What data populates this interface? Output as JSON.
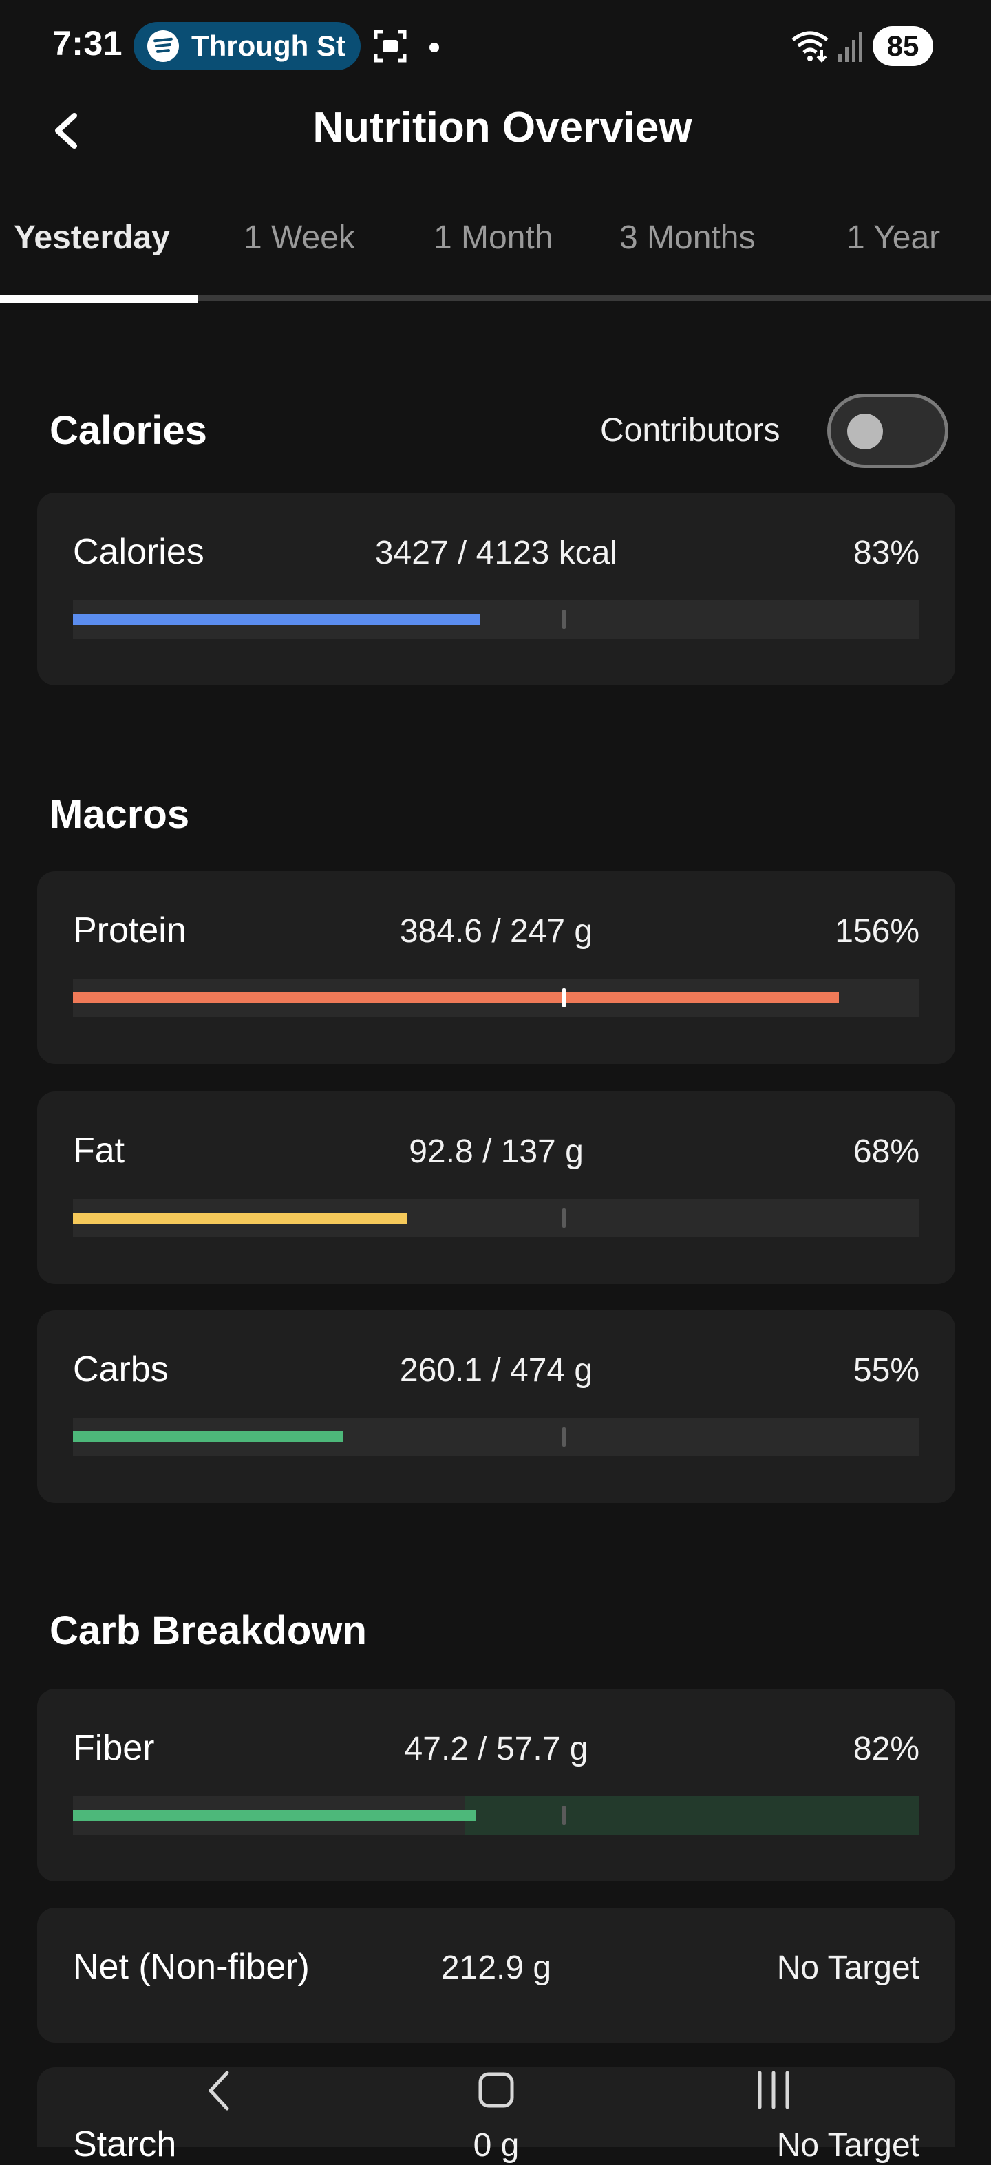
{
  "status_bar": {
    "time": "7:31",
    "media_text": "Through St",
    "battery": "85",
    "icons": [
      "spotify-icon",
      "screenshot-icon",
      "wifi-icon",
      "signal-icon"
    ]
  },
  "header": {
    "title": "Nutrition Overview",
    "back_icon": "chevron-left-icon"
  },
  "tabs": [
    {
      "label": "Yesterday",
      "active": true
    },
    {
      "label": "1 Week"
    },
    {
      "label": "1 Month"
    },
    {
      "label": "3 Months"
    },
    {
      "label": "1 Year"
    }
  ],
  "calories_section": {
    "title": "Calories",
    "contributors_label": "Contributors",
    "contributors_on": false,
    "card": {
      "name": "Calories",
      "amount": "3427 / 4123 kcal",
      "percent": "83%",
      "progress": 0.83,
      "color": "#5b8def"
    }
  },
  "macros_section": {
    "title": "Macros",
    "cards": [
      {
        "name": "Protein",
        "amount": "384.6 / 247 g",
        "percent": "156%",
        "progress": 1.56,
        "color": "#f07a58"
      },
      {
        "name": "Fat",
        "amount": "92.8 / 137 g",
        "percent": "68%",
        "progress": 0.68,
        "color": "#f5c95a"
      },
      {
        "name": "Carbs",
        "amount": "260.1 / 474 g",
        "percent": "55%",
        "progress": 0.55,
        "color": "#4db87a"
      }
    ]
  },
  "carb_breakdown_section": {
    "title": "Carb Breakdown",
    "cards": [
      {
        "name": "Fiber",
        "amount": "47.2 / 57.7 g",
        "percent": "82%",
        "progress": 0.82,
        "color": "#4db87a",
        "target_band_color": "#233a2c"
      },
      {
        "name": "Net (Non-fiber)",
        "amount": "212.9 g",
        "percent": "No Target"
      },
      {
        "name": "Starch",
        "amount": "0 g",
        "percent": "No Target"
      }
    ]
  },
  "nav_bar": {
    "icons": [
      "nav-back-icon",
      "nav-home-icon",
      "nav-recents-icon"
    ]
  }
}
